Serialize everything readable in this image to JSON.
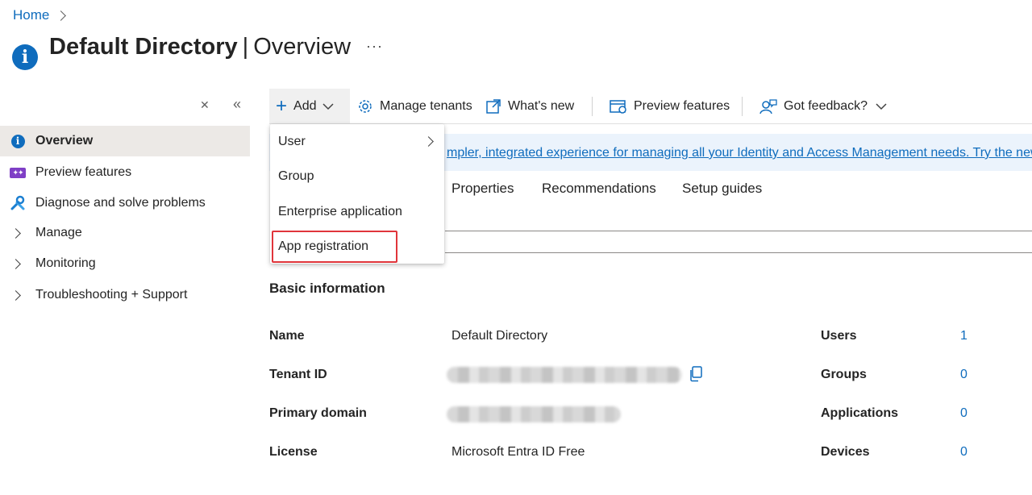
{
  "breadcrumb": {
    "home": "Home"
  },
  "header": {
    "title_main": "Default Directory",
    "separator": "|",
    "title_sub": "Overview",
    "more": "···"
  },
  "sidebar": {
    "items": [
      {
        "label": "Overview",
        "icon": "info-icon"
      },
      {
        "label": "Preview features",
        "icon": "preview-features-icon"
      },
      {
        "label": "Diagnose and solve problems",
        "icon": "wrench-icon"
      },
      {
        "label": "Manage",
        "icon": "chevron-right-icon"
      },
      {
        "label": "Monitoring",
        "icon": "chevron-right-icon"
      },
      {
        "label": "Troubleshooting + Support",
        "icon": "chevron-right-icon"
      }
    ]
  },
  "commandbar": {
    "add": "Add",
    "manage_tenants": "Manage tenants",
    "whats_new": "What's new",
    "preview_features": "Preview features",
    "feedback": "Got feedback?"
  },
  "banner": {
    "text": "mpler, integrated experience for managing all your Identity and Access Management needs. Try the new Mi"
  },
  "tabs": [
    "Properties",
    "Recommendations",
    "Setup guides"
  ],
  "add_menu": {
    "items": [
      "User",
      "Group",
      "Enterprise application",
      "App registration"
    ]
  },
  "basic_info": {
    "title": "Basic information",
    "name_label": "Name",
    "name_value": "Default Directory",
    "tenant_label": "Tenant ID",
    "domain_label": "Primary domain",
    "license_label": "License",
    "license_value": "Microsoft Entra ID Free"
  },
  "stats": [
    {
      "label": "Users",
      "value": "1"
    },
    {
      "label": "Groups",
      "value": "0"
    },
    {
      "label": "Applications",
      "value": "0"
    },
    {
      "label": "Devices",
      "value": "0"
    }
  ],
  "colors": {
    "accent": "#0f6cbd",
    "highlight": "#e0353b"
  }
}
